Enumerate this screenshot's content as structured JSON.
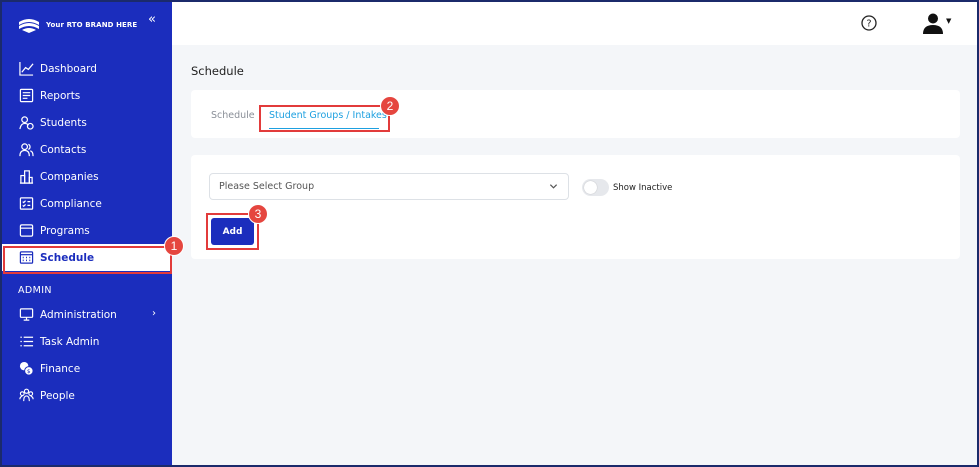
{
  "brand": {
    "name": "Your RTO BRAND HERE",
    "collapse_glyph": "«"
  },
  "sidebar": {
    "items": [
      {
        "label": "Dashboard",
        "icon": "chart-line-icon"
      },
      {
        "label": "Reports",
        "icon": "report-icon"
      },
      {
        "label": "Students",
        "icon": "students-icon"
      },
      {
        "label": "Contacts",
        "icon": "contacts-icon"
      },
      {
        "label": "Companies",
        "icon": "building-icon"
      },
      {
        "label": "Compliance",
        "icon": "checklist-icon"
      },
      {
        "label": "Programs",
        "icon": "window-icon"
      },
      {
        "label": "Schedule",
        "icon": "calendar-icon",
        "active": true
      }
    ],
    "admin_label": "ADMIN",
    "admin_items": [
      {
        "label": "Administration",
        "icon": "monitor-icon",
        "chevron": "›"
      },
      {
        "label": "Task Admin",
        "icon": "list-icon"
      },
      {
        "label": "Finance",
        "icon": "coins-icon"
      },
      {
        "label": "People",
        "icon": "people-icon"
      }
    ]
  },
  "topbar": {
    "help_icon": "question-circle-icon",
    "user_icon": "user-icon",
    "user_caret": "▼"
  },
  "main": {
    "page_title": "Schedule",
    "tabs": [
      {
        "label": "Schedule",
        "active": false
      },
      {
        "label": "Student Groups / Intakes",
        "active": true
      }
    ],
    "group_select": {
      "value": "Please Select Group"
    },
    "show_inactive_label": "Show Inactive",
    "show_inactive_on": false,
    "add_label": "Add"
  },
  "annotations": {
    "b1": "1",
    "b2": "2",
    "b3": "3"
  },
  "colors": {
    "sidebar": "#1b2dbd",
    "active_tab": "#1ea0e0",
    "highlight": "#e23b3b",
    "badge": "#e5463f"
  }
}
